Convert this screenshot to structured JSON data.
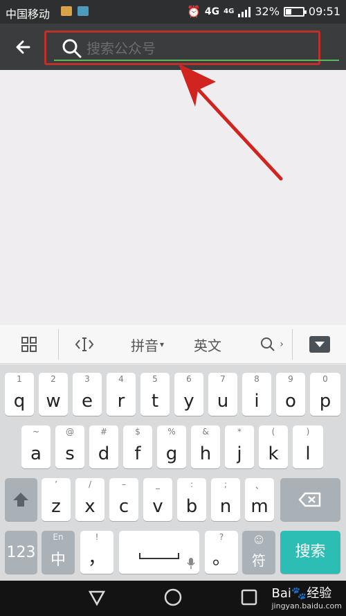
{
  "status_bar": {
    "carrier": "中国移动",
    "network": "4G",
    "signal_label": "4G",
    "battery": "32%",
    "time": "09:51"
  },
  "header": {
    "search_placeholder": "搜索公众号"
  },
  "keyboard_toolbar": {
    "mode_pinyin": "拼音",
    "mode_english": "英文"
  },
  "keyboard": {
    "row1": [
      {
        "sup": "1",
        "key": "q"
      },
      {
        "sup": "2",
        "key": "w"
      },
      {
        "sup": "3",
        "key": "e"
      },
      {
        "sup": "4",
        "key": "r"
      },
      {
        "sup": "5",
        "key": "t"
      },
      {
        "sup": "6",
        "key": "y"
      },
      {
        "sup": "7",
        "key": "u"
      },
      {
        "sup": "8",
        "key": "i"
      },
      {
        "sup": "9",
        "key": "o"
      },
      {
        "sup": "0",
        "key": "p"
      }
    ],
    "row2": [
      {
        "sup": "~",
        "key": "a"
      },
      {
        "sup": "@",
        "key": "s"
      },
      {
        "sup": "#",
        "key": "d"
      },
      {
        "sup": "$",
        "key": "f"
      },
      {
        "sup": "%",
        "key": "g"
      },
      {
        "sup": "&",
        "key": "h"
      },
      {
        "sup": "*",
        "key": "j"
      },
      {
        "sup": "(",
        "key": "k"
      },
      {
        "sup": ")",
        "key": "l"
      }
    ],
    "row3": [
      {
        "sup": "’",
        "key": "z"
      },
      {
        "sup": "/",
        "key": "x"
      },
      {
        "sup": "–",
        "key": "c"
      },
      {
        "sup": "_",
        "key": "v"
      },
      {
        "sup": ":",
        "key": "b"
      },
      {
        "sup": ";",
        "key": "n"
      },
      {
        "sup": "、",
        "key": "m"
      }
    ],
    "num_key": "123",
    "lang_key_sup": "En",
    "lang_key": "中",
    "punct_sup": "!",
    "punct": "，",
    "question_sup": "?",
    "period": "。",
    "symbol_key": "符",
    "search_key": "搜索"
  },
  "watermark": {
    "brand": "Bai",
    "product": "经验",
    "url": "jingyan.baidu.com"
  }
}
